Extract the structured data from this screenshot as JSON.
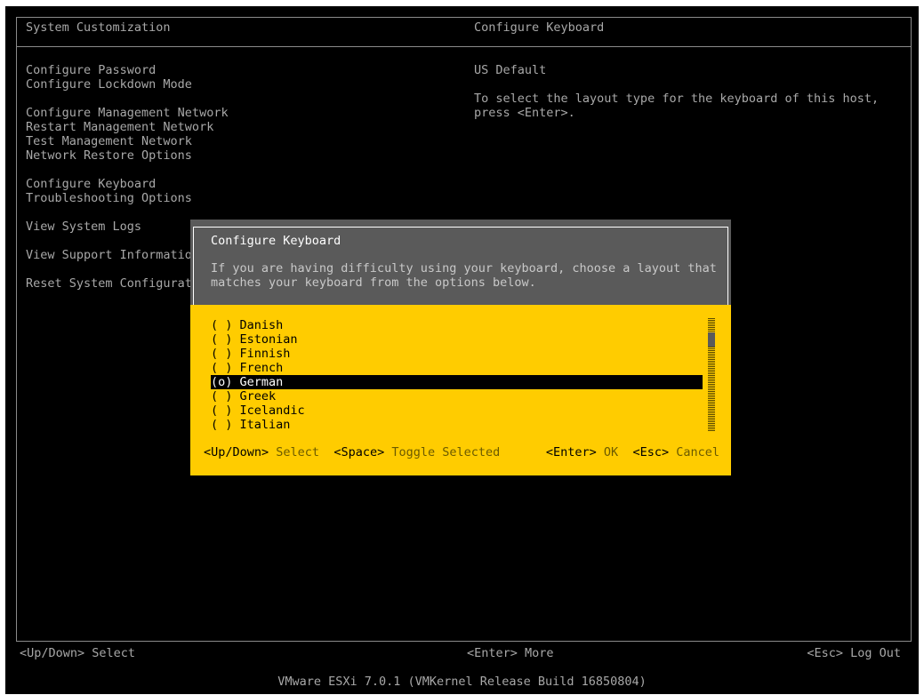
{
  "header": {
    "left_title": "System Customization",
    "right_title": "Configure Keyboard"
  },
  "menu": {
    "items": [
      "Configure Password",
      "Configure Lockdown Mode",
      "",
      "Configure Management Network",
      "Restart Management Network",
      "Test Management Network",
      "Network Restore Options",
      "",
      "Configure Keyboard",
      "Troubleshooting Options",
      "",
      "View System Logs",
      "",
      "View Support Informatio",
      "",
      "Reset System Configurat"
    ]
  },
  "right_panel": {
    "current_layout": "US Default",
    "help_line1": "To select the layout type for the keyboard of this host,",
    "help_line2": "press <Enter>."
  },
  "dialog": {
    "title": "Configure Keyboard",
    "desc_line1": "If you are having difficulty using your keyboard, choose a layout that",
    "desc_line2": "matches your keyboard from the options below.",
    "options": [
      {
        "label": "( ) Danish"
      },
      {
        "label": "( ) Estonian"
      },
      {
        "label": "( ) Finnish"
      },
      {
        "label": "( ) French"
      },
      {
        "label": "(o) German"
      },
      {
        "label": "( ) Greek"
      },
      {
        "label": "( ) Icelandic"
      },
      {
        "label": "( ) Italian"
      }
    ],
    "footer": {
      "updown_key": "<Up/Down>",
      "updown_action": "Select",
      "space_key": "<Space>",
      "space_action": "Toggle Selected",
      "enter_key": "<Enter>",
      "enter_action": "OK",
      "esc_key": "<Esc>",
      "esc_action": "Cancel"
    }
  },
  "status_bar": {
    "left": "<Up/Down> Select",
    "center": "<Enter> More",
    "right": "<Esc> Log Out"
  },
  "version": "VMware ESXi 7.0.1 (VMKernel Release Build 16850804)",
  "colors": {
    "background": "#000000",
    "text": "#a8a8a8",
    "dialog_accent": "#ffcc00",
    "dialog_header": "#5a5a5a"
  }
}
